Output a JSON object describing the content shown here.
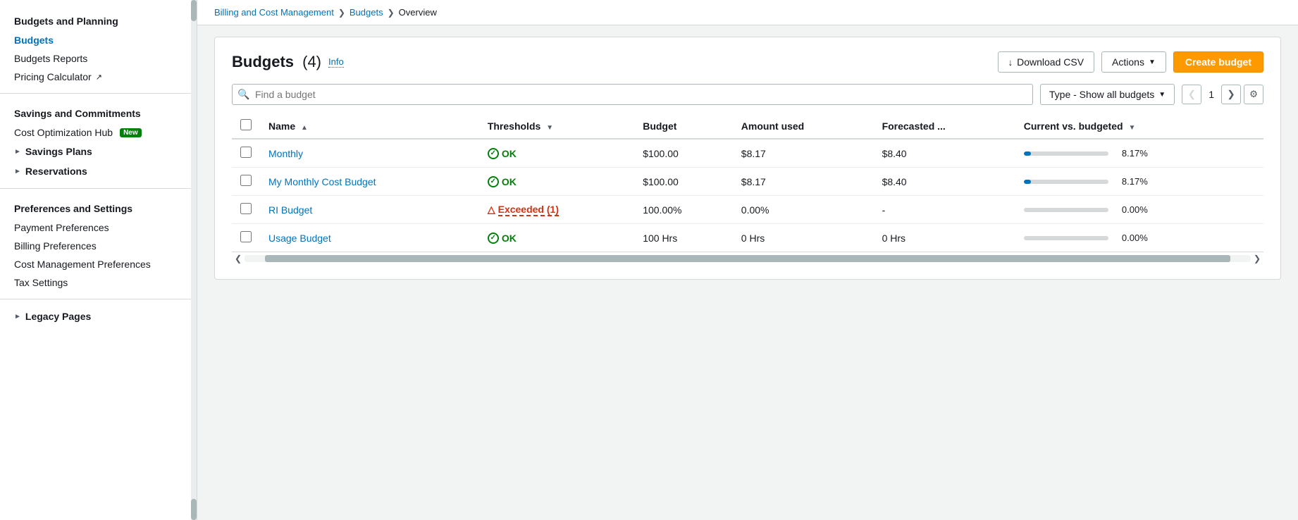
{
  "sidebar": {
    "section1_title": "Budgets and Planning",
    "items_section1": [
      {
        "label": "Budgets",
        "active": true,
        "link": true
      },
      {
        "label": "Budgets Reports",
        "active": false,
        "link": true
      },
      {
        "label": "Pricing Calculator",
        "active": false,
        "link": true,
        "external": true
      }
    ],
    "section2_title": "Savings and Commitments",
    "items_section2": [
      {
        "label": "Cost Optimization Hub",
        "active": false,
        "link": true,
        "badge": "New"
      }
    ],
    "collapsible1": "Savings Plans",
    "collapsible2": "Reservations",
    "section3_title": "Preferences and Settings",
    "items_section3": [
      {
        "label": "Payment Preferences"
      },
      {
        "label": "Billing Preferences"
      },
      {
        "label": "Cost Management Preferences"
      },
      {
        "label": "Tax Settings"
      }
    ],
    "collapsible3": "Legacy Pages"
  },
  "breadcrumb": {
    "items": [
      {
        "label": "Billing and Cost Management",
        "link": true
      },
      {
        "label": "Budgets",
        "link": true
      },
      {
        "label": "Overview",
        "link": false
      }
    ]
  },
  "page": {
    "title": "Budgets",
    "count": "(4)",
    "info_label": "Info",
    "download_csv_label": "Download CSV",
    "actions_label": "Actions",
    "create_budget_label": "Create budget",
    "search_placeholder": "Find a budget",
    "type_filter_label": "Type - Show all budgets",
    "page_number": "1"
  },
  "table": {
    "columns": [
      {
        "label": "Name",
        "sortable": true,
        "sort_dir": "asc"
      },
      {
        "label": "Thresholds",
        "sortable": true,
        "sort_dir": "desc"
      },
      {
        "label": "Budget",
        "sortable": false
      },
      {
        "label": "Amount used",
        "sortable": false
      },
      {
        "label": "Forecasted ...",
        "sortable": false
      },
      {
        "label": "Current vs. budgeted",
        "sortable": true,
        "sort_dir": "desc"
      }
    ],
    "rows": [
      {
        "name": "Monthly",
        "status": "OK",
        "status_type": "ok",
        "budget": "$100.00",
        "amount_used": "$8.17",
        "forecasted": "$8.40",
        "progress_pct": 8.17,
        "progress_label": "8.17%"
      },
      {
        "name": "My Monthly Cost Budget",
        "status": "OK",
        "status_type": "ok",
        "budget": "$100.00",
        "amount_used": "$8.17",
        "forecasted": "$8.40",
        "progress_pct": 8.17,
        "progress_label": "8.17%"
      },
      {
        "name": "RI Budget",
        "status": "Exceeded (1)",
        "status_type": "exceeded",
        "budget": "100.00%",
        "amount_used": "0.00%",
        "forecasted": "-",
        "progress_pct": 0,
        "progress_label": "0.00%"
      },
      {
        "name": "Usage Budget",
        "status": "OK",
        "status_type": "ok",
        "budget": "100 Hrs",
        "amount_used": "0 Hrs",
        "forecasted": "0 Hrs",
        "progress_pct": 0,
        "progress_label": "0.00%"
      }
    ]
  }
}
